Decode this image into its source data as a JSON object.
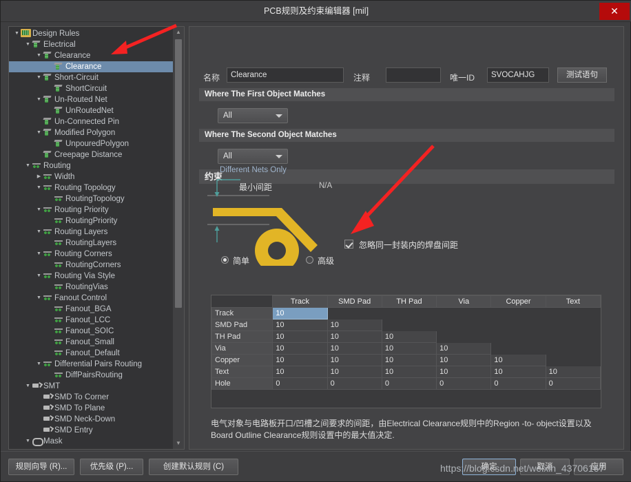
{
  "window": {
    "title": "PCB规则及约束编辑器 [mil]",
    "close_label": "✕"
  },
  "tree": {
    "nodes": [
      {
        "label": "Design Rules",
        "depth": 0,
        "icon": "folder-icon",
        "arrow": "down",
        "selected": false
      },
      {
        "label": "Electrical",
        "depth": 1,
        "icon": "electrical-icon",
        "arrow": "down",
        "selected": false
      },
      {
        "label": "Clearance",
        "depth": 2,
        "icon": "electrical-icon",
        "arrow": "down",
        "selected": false
      },
      {
        "label": "Clearance",
        "depth": 3,
        "icon": "electrical-icon",
        "arrow": "none",
        "selected": true
      },
      {
        "label": "Short-Circuit",
        "depth": 2,
        "icon": "electrical-icon",
        "arrow": "down",
        "selected": false
      },
      {
        "label": "ShortCircuit",
        "depth": 3,
        "icon": "electrical-icon",
        "arrow": "none",
        "selected": false
      },
      {
        "label": "Un-Routed Net",
        "depth": 2,
        "icon": "electrical-icon",
        "arrow": "down",
        "selected": false
      },
      {
        "label": "UnRoutedNet",
        "depth": 3,
        "icon": "electrical-icon",
        "arrow": "none",
        "selected": false
      },
      {
        "label": "Un-Connected Pin",
        "depth": 2,
        "icon": "electrical-icon",
        "arrow": "none",
        "selected": false
      },
      {
        "label": "Modified Polygon",
        "depth": 2,
        "icon": "electrical-icon",
        "arrow": "down",
        "selected": false
      },
      {
        "label": "UnpouredPolygon",
        "depth": 3,
        "icon": "electrical-icon",
        "arrow": "none",
        "selected": false
      },
      {
        "label": "Creepage Distance",
        "depth": 2,
        "icon": "electrical-icon",
        "arrow": "none",
        "selected": false
      },
      {
        "label": "Routing",
        "depth": 1,
        "icon": "routing-icon",
        "arrow": "down",
        "selected": false
      },
      {
        "label": "Width",
        "depth": 2,
        "icon": "routing-icon",
        "arrow": "right",
        "selected": false
      },
      {
        "label": "Routing Topology",
        "depth": 2,
        "icon": "routing-icon",
        "arrow": "down",
        "selected": false
      },
      {
        "label": "RoutingTopology",
        "depth": 3,
        "icon": "routing-icon",
        "arrow": "none",
        "selected": false
      },
      {
        "label": "Routing Priority",
        "depth": 2,
        "icon": "routing-icon",
        "arrow": "down",
        "selected": false
      },
      {
        "label": "RoutingPriority",
        "depth": 3,
        "icon": "routing-icon",
        "arrow": "none",
        "selected": false
      },
      {
        "label": "Routing Layers",
        "depth": 2,
        "icon": "routing-icon",
        "arrow": "down",
        "selected": false
      },
      {
        "label": "RoutingLayers",
        "depth": 3,
        "icon": "routing-icon",
        "arrow": "none",
        "selected": false
      },
      {
        "label": "Routing Corners",
        "depth": 2,
        "icon": "routing-icon",
        "arrow": "down",
        "selected": false
      },
      {
        "label": "RoutingCorners",
        "depth": 3,
        "icon": "routing-icon",
        "arrow": "none",
        "selected": false
      },
      {
        "label": "Routing Via Style",
        "depth": 2,
        "icon": "routing-icon",
        "arrow": "down",
        "selected": false
      },
      {
        "label": "RoutingVias",
        "depth": 3,
        "icon": "routing-icon",
        "arrow": "none",
        "selected": false
      },
      {
        "label": "Fanout Control",
        "depth": 2,
        "icon": "routing-icon",
        "arrow": "down",
        "selected": false
      },
      {
        "label": "Fanout_BGA",
        "depth": 3,
        "icon": "routing-icon",
        "arrow": "none",
        "selected": false
      },
      {
        "label": "Fanout_LCC",
        "depth": 3,
        "icon": "routing-icon",
        "arrow": "none",
        "selected": false
      },
      {
        "label": "Fanout_SOIC",
        "depth": 3,
        "icon": "routing-icon",
        "arrow": "none",
        "selected": false
      },
      {
        "label": "Fanout_Small",
        "depth": 3,
        "icon": "routing-icon",
        "arrow": "none",
        "selected": false
      },
      {
        "label": "Fanout_Default",
        "depth": 3,
        "icon": "routing-icon",
        "arrow": "none",
        "selected": false
      },
      {
        "label": "Differential Pairs Routing",
        "depth": 2,
        "icon": "routing-icon",
        "arrow": "down",
        "selected": false
      },
      {
        "label": "DiffPairsRouting",
        "depth": 3,
        "icon": "routing-icon",
        "arrow": "none",
        "selected": false
      },
      {
        "label": "SMT",
        "depth": 1,
        "icon": "smt-icon",
        "arrow": "down",
        "selected": false
      },
      {
        "label": "SMD To Corner",
        "depth": 2,
        "icon": "smt-icon",
        "arrow": "none",
        "selected": false
      },
      {
        "label": "SMD To Plane",
        "depth": 2,
        "icon": "smt-icon",
        "arrow": "none",
        "selected": false
      },
      {
        "label": "SMD Neck-Down",
        "depth": 2,
        "icon": "smt-icon",
        "arrow": "none",
        "selected": false
      },
      {
        "label": "SMD Entry",
        "depth": 2,
        "icon": "smt-icon",
        "arrow": "none",
        "selected": false
      },
      {
        "label": "Mask",
        "depth": 1,
        "icon": "mask-icon",
        "arrow": "down",
        "selected": false
      }
    ]
  },
  "form": {
    "name_label": "名称",
    "name_value": "Clearance",
    "comment_label": "注释",
    "comment_value": "",
    "comment_placeholder": "",
    "uid_label": "唯一ID",
    "uid_value": "SVOCAHJG",
    "test_button": "测试语句"
  },
  "first_match": {
    "header": "Where The First Object Matches",
    "scope_value": "All"
  },
  "second_match": {
    "header": "Where The Second Object Matches",
    "scope_value": "All"
  },
  "constraints": {
    "header": "约束",
    "diagram_title": "Different Nets Only",
    "min_gap_label": "最小间距",
    "na_label": "N/A",
    "ignore_checkbox_label": "忽略同一封装内的焊盘间距",
    "ignore_checked": true,
    "mode_simple": "简单",
    "mode_advanced": "高级",
    "mode_selected": "简单"
  },
  "matrix": {
    "columns": [
      "",
      "Track",
      "SMD Pad",
      "TH Pad",
      "Via",
      "Copper",
      "Text"
    ],
    "rows": [
      {
        "header": "Track",
        "values": [
          "10",
          "",
          "",
          "",
          "",
          ""
        ]
      },
      {
        "header": "SMD Pad",
        "values": [
          "10",
          "10",
          "",
          "",
          "",
          ""
        ]
      },
      {
        "header": "TH Pad",
        "values": [
          "10",
          "10",
          "10",
          "",
          "",
          ""
        ]
      },
      {
        "header": "Via",
        "values": [
          "10",
          "10",
          "10",
          "10",
          "",
          ""
        ]
      },
      {
        "header": "Copper",
        "values": [
          "10",
          "10",
          "10",
          "10",
          "10",
          ""
        ]
      },
      {
        "header": "Text",
        "values": [
          "10",
          "10",
          "10",
          "10",
          "10",
          "10"
        ]
      },
      {
        "header": "Hole",
        "values": [
          "0",
          "0",
          "0",
          "0",
          "0",
          "0"
        ]
      }
    ],
    "selected_row": 0,
    "selected_col": 0
  },
  "description": "电气对象与电路板开口/凹槽之间要求的间距，由Electrical Clearance规则中的Region -to- object设置以及Board Outline Clearance规则设置中的最大值决定.",
  "footer": {
    "wizard_button": "规则向导 (R)...",
    "priority_button": "优先级 (P)...",
    "create_default_button": "创建默认规则 (C)",
    "ok_button": "确定",
    "cancel_button": "取消",
    "apply_button": "应用",
    "watermark": "https://blog.csdn.net/weixin_43706167"
  },
  "colors": {
    "accent_selection": "#6d8bab",
    "close_red": "#b50b0b",
    "trace_gold": "#e2b526",
    "annotation_red": "#f42222",
    "dimension_teal": "#4e9e9b"
  }
}
